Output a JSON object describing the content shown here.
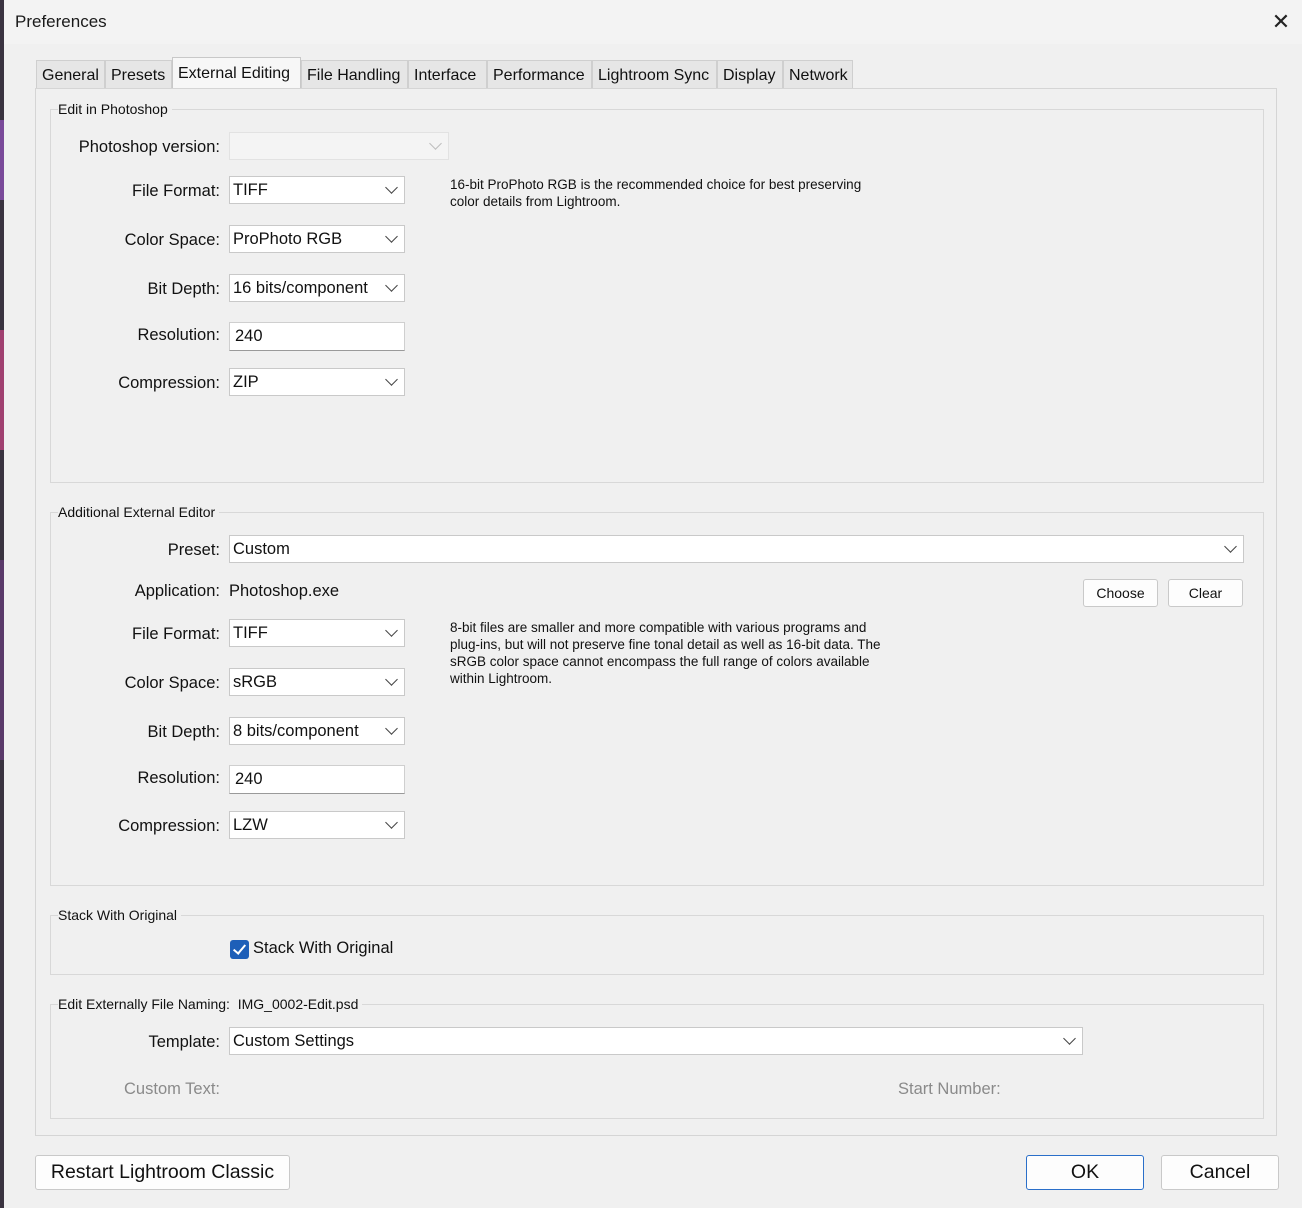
{
  "window": {
    "title": "Preferences"
  },
  "tabs": [
    {
      "label": "General",
      "active": false
    },
    {
      "label": "Presets",
      "active": false
    },
    {
      "label": "External Editing",
      "active": true
    },
    {
      "label": "File Handling",
      "active": false
    },
    {
      "label": "Interface",
      "active": false
    },
    {
      "label": "Performance",
      "active": false
    },
    {
      "label": "Lightroom Sync",
      "active": false
    },
    {
      "label": "Display",
      "active": false
    },
    {
      "label": "Network",
      "active": false
    }
  ],
  "photoshop": {
    "legend": "Edit in Photoshop",
    "version_label": "Photoshop version:",
    "version_value": "",
    "file_format_label": "File Format:",
    "file_format": "TIFF",
    "color_space_label": "Color Space:",
    "color_space": "ProPhoto RGB",
    "bit_depth_label": "Bit Depth:",
    "bit_depth": "16 bits/component",
    "resolution_label": "Resolution:",
    "resolution": "240",
    "compression_label": "Compression:",
    "compression": "ZIP",
    "note_line1": "16-bit ProPhoto RGB is the recommended choice for best preserving",
    "note_line2": "color details from Lightroom."
  },
  "additional": {
    "legend": "Additional External Editor",
    "preset_label": "Preset:",
    "preset": "Custom",
    "application_label": "Application:",
    "application": "Photoshop.exe",
    "choose_label": "Choose",
    "clear_label": "Clear",
    "file_format_label": "File Format:",
    "file_format": "TIFF",
    "color_space_label": "Color Space:",
    "color_space": "sRGB",
    "bit_depth_label": "Bit Depth:",
    "bit_depth": "8 bits/component",
    "resolution_label": "Resolution:",
    "resolution": "240",
    "compression_label": "Compression:",
    "compression": "LZW",
    "note_line1": "8-bit files are smaller and more compatible with various programs and",
    "note_line2": "plug-ins, but will not preserve fine tonal detail as well as 16-bit data. The",
    "note_line3": "sRGB color space cannot encompass the full range of colors available",
    "note_line4": "within Lightroom."
  },
  "stack": {
    "legend": "Stack With Original",
    "checkbox_label": "Stack With Original",
    "checked": true
  },
  "naming": {
    "legend": "Edit Externally File Naming:",
    "example": "IMG_0002-Edit.psd",
    "template_label": "Template:",
    "template": "Custom Settings",
    "custom_text_label": "Custom Text:",
    "start_number_label": "Start Number:"
  },
  "footer": {
    "restart_label": "Restart Lightroom Classic",
    "ok_label": "OK",
    "cancel_label": "Cancel"
  },
  "colors": {
    "checkbox_fill": "#1e5fb8",
    "ok_border": "#2a6fc9"
  }
}
